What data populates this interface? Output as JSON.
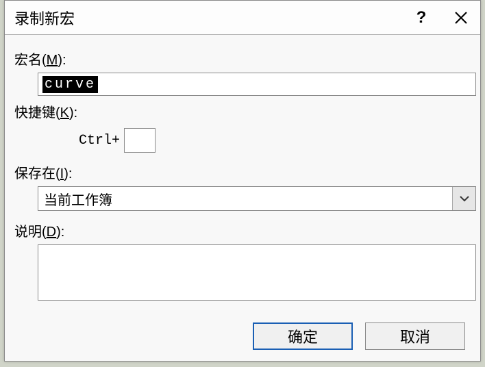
{
  "dialog": {
    "title": "录制新宏",
    "help_symbol": "?",
    "macro_name": {
      "label_pre": "宏名(",
      "mnemo": "M",
      "label_post": "):",
      "value": "curve"
    },
    "shortcut": {
      "label_pre": "快捷键(",
      "mnemo": "K",
      "label_post": "):",
      "prefix": "Ctrl+",
      "value": ""
    },
    "store_in": {
      "label_pre": "保存在(",
      "mnemo": "I",
      "label_post": "):",
      "selected": "当前工作簿"
    },
    "description": {
      "label_pre": "说明(",
      "mnemo": "D",
      "label_post": "):",
      "value": ""
    },
    "buttons": {
      "ok": "确定",
      "cancel": "取消"
    }
  }
}
